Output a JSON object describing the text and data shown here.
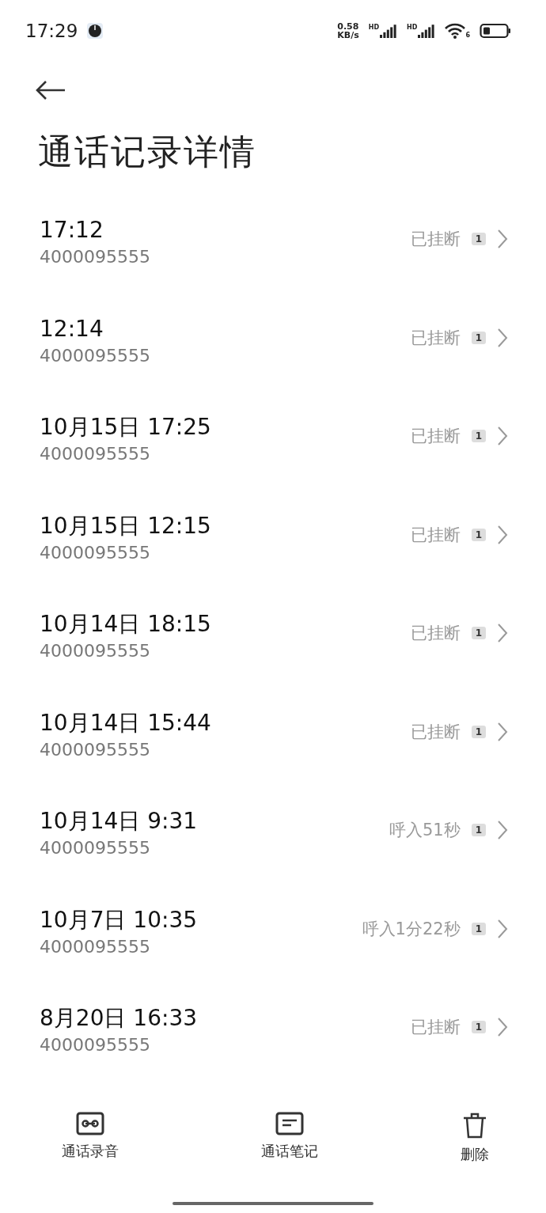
{
  "status_bar": {
    "time": "17:29",
    "speed": "0.58",
    "speed_unit": "KB/s",
    "network_1": "HD",
    "network_2": "HD",
    "wifi_level": "6"
  },
  "title": "通话记录详情",
  "calls": [
    {
      "time": "17:12",
      "number": "4000095555",
      "status": "已挂断",
      "sim": "1"
    },
    {
      "time": "12:14",
      "number": "4000095555",
      "status": "已挂断",
      "sim": "1"
    },
    {
      "time": "10月15日 17:25",
      "number": "4000095555",
      "status": "已挂断",
      "sim": "1"
    },
    {
      "time": "10月15日 12:15",
      "number": "4000095555",
      "status": "已挂断",
      "sim": "1"
    },
    {
      "time": "10月14日 18:15",
      "number": "4000095555",
      "status": "已挂断",
      "sim": "1"
    },
    {
      "time": "10月14日 15:44",
      "number": "4000095555",
      "status": "已挂断",
      "sim": "1"
    },
    {
      "time": "10月14日 9:31",
      "number": "4000095555",
      "status": "呼入51秒",
      "sim": "1"
    },
    {
      "time": "10月7日 10:35",
      "number": "4000095555",
      "status": "呼入1分22秒",
      "sim": "1"
    },
    {
      "time": "8月20日 16:33",
      "number": "4000095555",
      "status": "已挂断",
      "sim": "1"
    }
  ],
  "actions": [
    {
      "kind": "recording",
      "label": "通话录音"
    },
    {
      "kind": "notes",
      "label": "通话笔记"
    },
    {
      "kind": "delete",
      "label": "删除"
    }
  ]
}
